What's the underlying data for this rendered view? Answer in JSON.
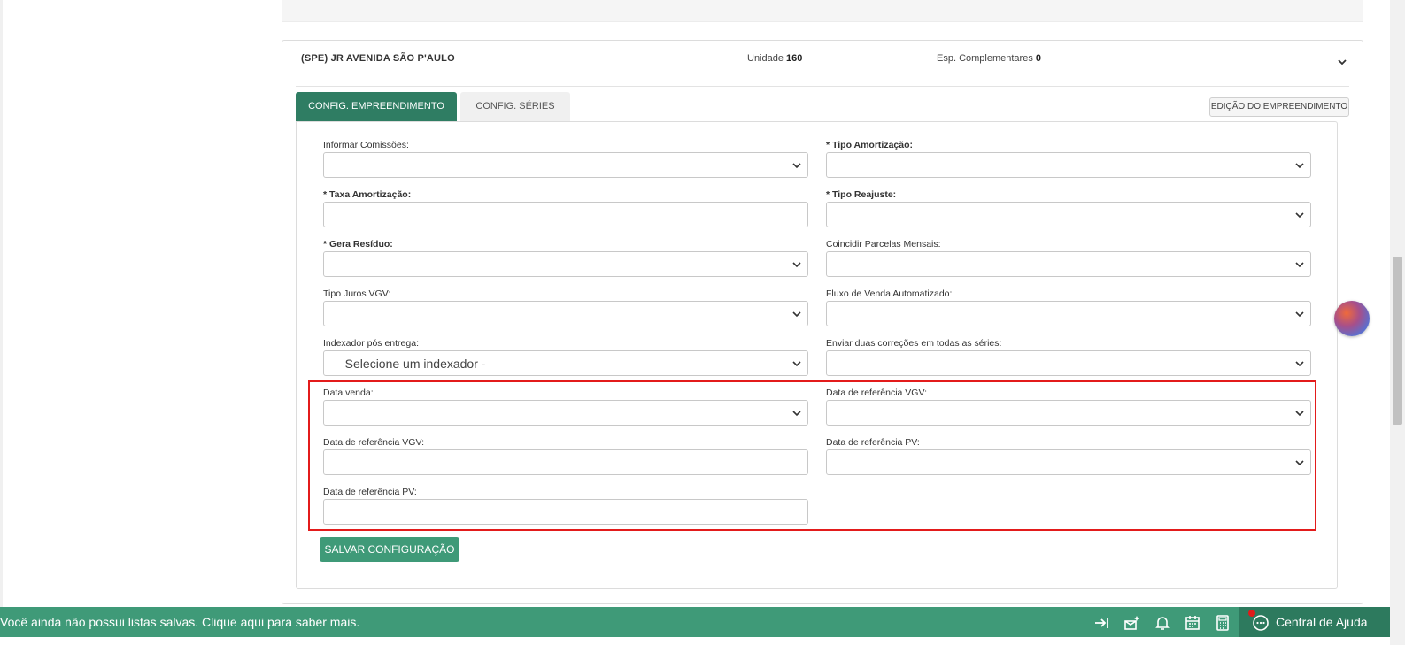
{
  "card": {
    "title": "(SPE) JR AVENIDA SÃO P'AULO",
    "unit_label": "Unidade",
    "unit_value": "160",
    "esp_label": "Esp. Complementares",
    "esp_value": "0"
  },
  "tabs": [
    {
      "label": "CONFIG. EMPREENDIMENTO",
      "active": true
    },
    {
      "label": "CONFIG. SÉRIES",
      "active": false
    }
  ],
  "edit_button": "EDIÇÃO DO EMPREENDIMENTO",
  "fields": {
    "informar_comissoes": {
      "label": "Informar Comissões:",
      "value": ""
    },
    "tipo_amortizacao": {
      "req": "*",
      "label": "Tipo Amortização:",
      "value": ""
    },
    "taxa_amortizacao": {
      "req": "*",
      "label": "Taxa Amortização:",
      "value": ""
    },
    "tipo_reajuste": {
      "req": "*",
      "label": "Tipo Reajuste:",
      "value": ""
    },
    "gera_residuo": {
      "req": "*",
      "label": "Gera Resíduo:",
      "value": ""
    },
    "coincidir_parcelas": {
      "label": "Coincidir Parcelas Mensais:",
      "value": ""
    },
    "tipo_juros_vgv": {
      "label": "Tipo Juros VGV:",
      "value": ""
    },
    "fluxo_venda": {
      "label": "Fluxo de Venda Automatizado:",
      "value": ""
    },
    "indexador": {
      "label": "Indexador pós entrega:",
      "value": "– Selecione um indexador -"
    },
    "enviar_correcoes": {
      "label": "Enviar duas correções em todas as séries:",
      "value": ""
    },
    "data_venda": {
      "label": "Data venda:",
      "value": ""
    },
    "data_ref_vgv_select": {
      "label": "Data de referência VGV:",
      "value": ""
    },
    "data_ref_vgv_input": {
      "label": "Data de referência VGV:",
      "value": ""
    },
    "data_ref_pv_select": {
      "label": "Data de referência PV:",
      "value": ""
    },
    "data_ref_pv_input": {
      "label": "Data de referência PV:",
      "value": ""
    }
  },
  "save_button": "SALVAR CONFIGURAÇÃO",
  "bottom_bar": {
    "message": "Você ainda não possui listas salvas. Clique aqui para saber mais.",
    "help_label": "Central de Ajuda",
    "icons": [
      "collapse-right-icon",
      "gift-sparkle-icon",
      "bell-icon",
      "calendar-icon",
      "calculator-icon",
      "chat-help-icon"
    ]
  },
  "colors": {
    "primary_green": "#3f9a78",
    "active_tab": "#2f7d63",
    "highlight_red": "#e31b1b"
  }
}
